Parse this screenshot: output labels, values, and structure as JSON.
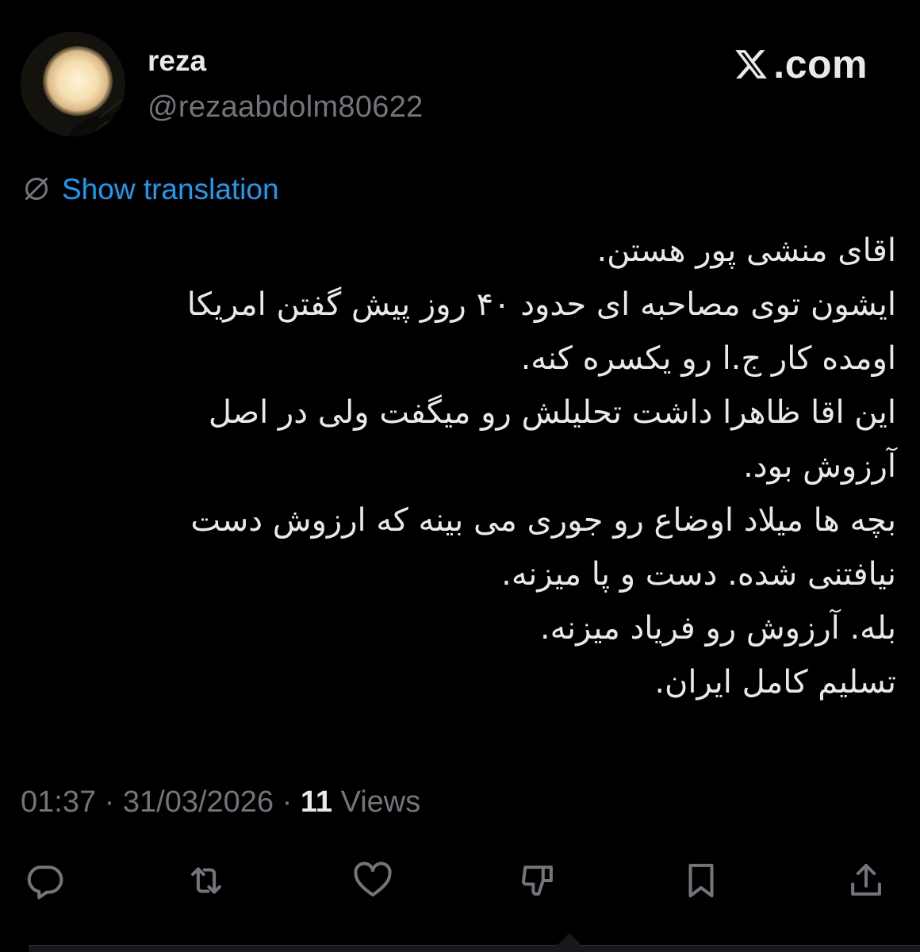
{
  "user": {
    "display_name": "reza",
    "handle": "@rezaabdolm80622",
    "avatar_icon": "moon-photo-avatar"
  },
  "source": {
    "domain": ".com",
    "logo_icon": "x-logo-icon"
  },
  "translation": {
    "label": "Show translation",
    "icon": "globe-icon",
    "color": "#1d9bf0"
  },
  "tweet": {
    "lines": [
      "اقای منشی پور هستن.",
      "ایشون توی مصاحبه ای حدود ۴۰ روز پیش گفتن امریکا",
      "اومده کار ج.ا رو یکسره کنه.",
      "این اقا ظاهرا داشت تحلیلش رو میگفت ولی در اصل",
      "آرزوش بود.",
      "بچه ها میلاد اوضاع رو جوری می بینه که ارزوش دست",
      "نیافتنی شده. دست و پا میزنه.",
      "بله. آرزوش رو فریاد میزنه.",
      "تسلیم کامل ایران."
    ]
  },
  "meta": {
    "time": "01:37",
    "separator": " · ",
    "date": "31/03/2026",
    "views_count": "11",
    "views_label": " Views"
  },
  "actions": [
    {
      "name": "reply-icon"
    },
    {
      "name": "repost-icon"
    },
    {
      "name": "like-icon"
    },
    {
      "name": "dislike-icon"
    },
    {
      "name": "bookmark-icon"
    },
    {
      "name": "share-icon"
    }
  ],
  "colors": {
    "background": "#000000",
    "text": "#e7e9ea",
    "muted": "#71767b",
    "link": "#1d9bf0"
  }
}
